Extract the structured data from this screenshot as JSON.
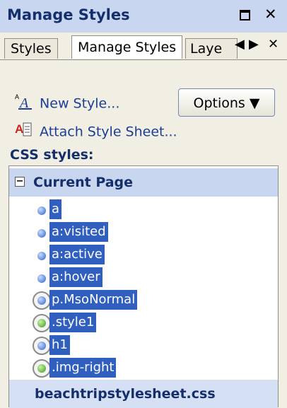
{
  "window": {
    "title": "Manage Styles"
  },
  "tabs": [
    {
      "label": "Styles"
    },
    {
      "label": "Manage Styles",
      "active": true
    },
    {
      "label": "Laye"
    }
  ],
  "actions": {
    "new_style": "New Style...",
    "attach": "Attach Style Sheet...",
    "options": "Options ▼"
  },
  "section_label": "CSS styles:",
  "groups": [
    {
      "label": "Current Page",
      "expander": "−"
    },
    {
      "label": "beachtripstylesheet.css"
    }
  ],
  "styles": [
    {
      "name": "a",
      "icon": "blue-dot"
    },
    {
      "name": "a:visited",
      "icon": "blue-dot"
    },
    {
      "name": "a:active",
      "icon": "blue-dot"
    },
    {
      "name": "a:hover",
      "icon": "blue-dot"
    },
    {
      "name": "p.MsoNormal",
      "icon": "blue-ringed-dot"
    },
    {
      "name": ".style1",
      "icon": "green-ringed-dot"
    },
    {
      "name": "h1",
      "icon": "blue-ringed-dot"
    },
    {
      "name": ".img-right",
      "icon": "green-ringed-dot"
    }
  ],
  "colors": {
    "accent": "#315fbf",
    "header": "#c9d6ef",
    "title": "#142f6c"
  }
}
